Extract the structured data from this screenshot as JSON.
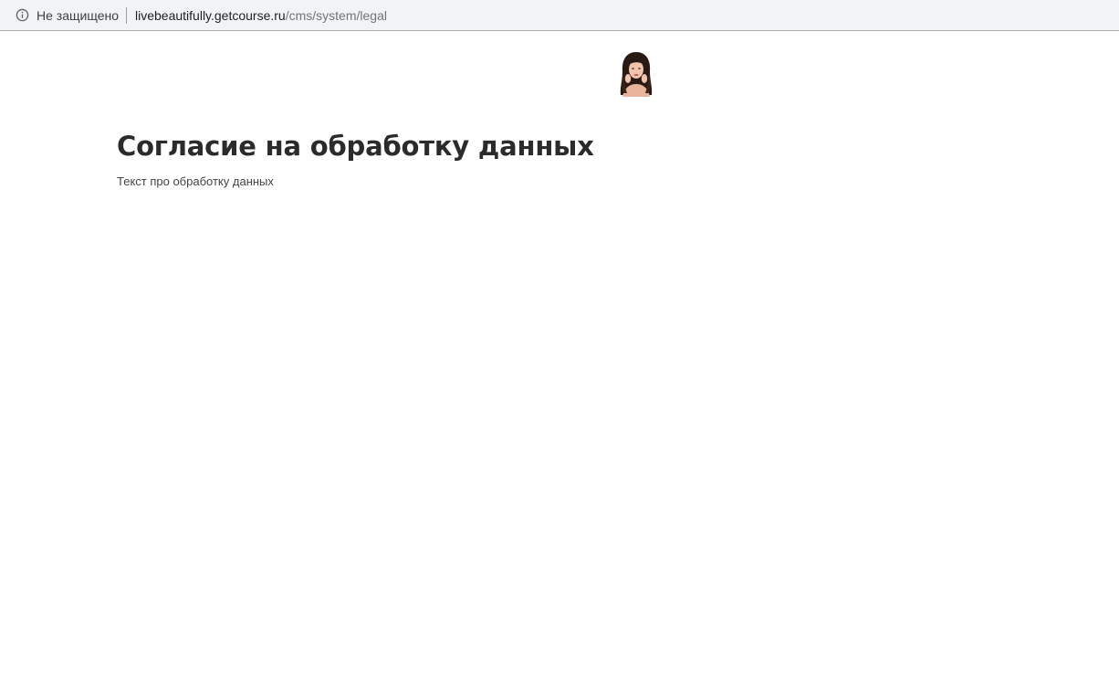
{
  "browser": {
    "security_icon": "info-icon",
    "security_label": "Не защищено",
    "url_host": "livebeautifully.getcourse.ru",
    "url_path": "/cms/system/legal"
  },
  "page": {
    "logo_icon": "avatar-woman-portrait",
    "title": "Согласие на обработку данных",
    "body_text": "Текст про обработку данных"
  },
  "colors": {
    "addressbar_bg": "#f1f3f4",
    "title_text": "#2b2b2b",
    "body_text": "#444444"
  }
}
